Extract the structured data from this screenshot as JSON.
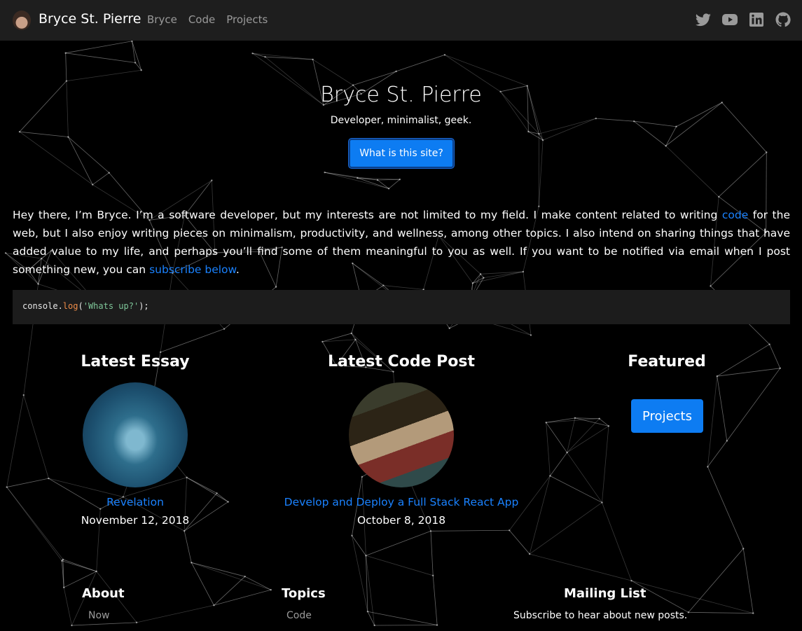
{
  "nav": {
    "brand": "Bryce St. Pierre",
    "links": [
      "Bryce",
      "Code",
      "Projects"
    ],
    "social": [
      "twitter-icon",
      "youtube-icon",
      "linkedin-icon",
      "github-icon"
    ]
  },
  "hero": {
    "title": "Bryce St. Pierre",
    "subtitle": "Developer, minimalist, geek.",
    "button": "What is this site?"
  },
  "intro": {
    "text_1": "Hey there, I’m Bryce. I’m a software developer, but my interests are not limited to my field. I make content related to writing ",
    "link_code": "code",
    "text_2": " for the web, but I also enjoy writing pieces on minimalism, productivity, and wellness, among other topics. I also intend on sharing things that have added value to my life, and perhaps you’ll find some of them meaningful to you as well. If you want to be notified via email when I post something new, you can ",
    "link_subscribe": "subscribe below",
    "text_3": "."
  },
  "code": {
    "object": "console.",
    "method": "log",
    "open": "(",
    "string": "'Whats up?'",
    "close": ");"
  },
  "sections": {
    "essay": {
      "title": "Latest Essay",
      "link": "Revelation",
      "date": "November 12, 2018"
    },
    "code_post": {
      "title": "Latest Code Post",
      "link": "Develop and Deploy a Full Stack React App",
      "date": "October 8, 2018"
    },
    "featured": {
      "title": "Featured",
      "button": "Projects"
    }
  },
  "footer": {
    "about": {
      "title": "About",
      "links": [
        "Now"
      ]
    },
    "topics": {
      "title": "Topics",
      "links": [
        "Code"
      ]
    },
    "mailing": {
      "title": "Mailing List",
      "text": "Subscribe to hear about new posts."
    }
  },
  "colors": {
    "accent": "#0d7cf2",
    "link": "#1a82ff",
    "navbar": "#1e1e1e",
    "background": "#000000"
  }
}
